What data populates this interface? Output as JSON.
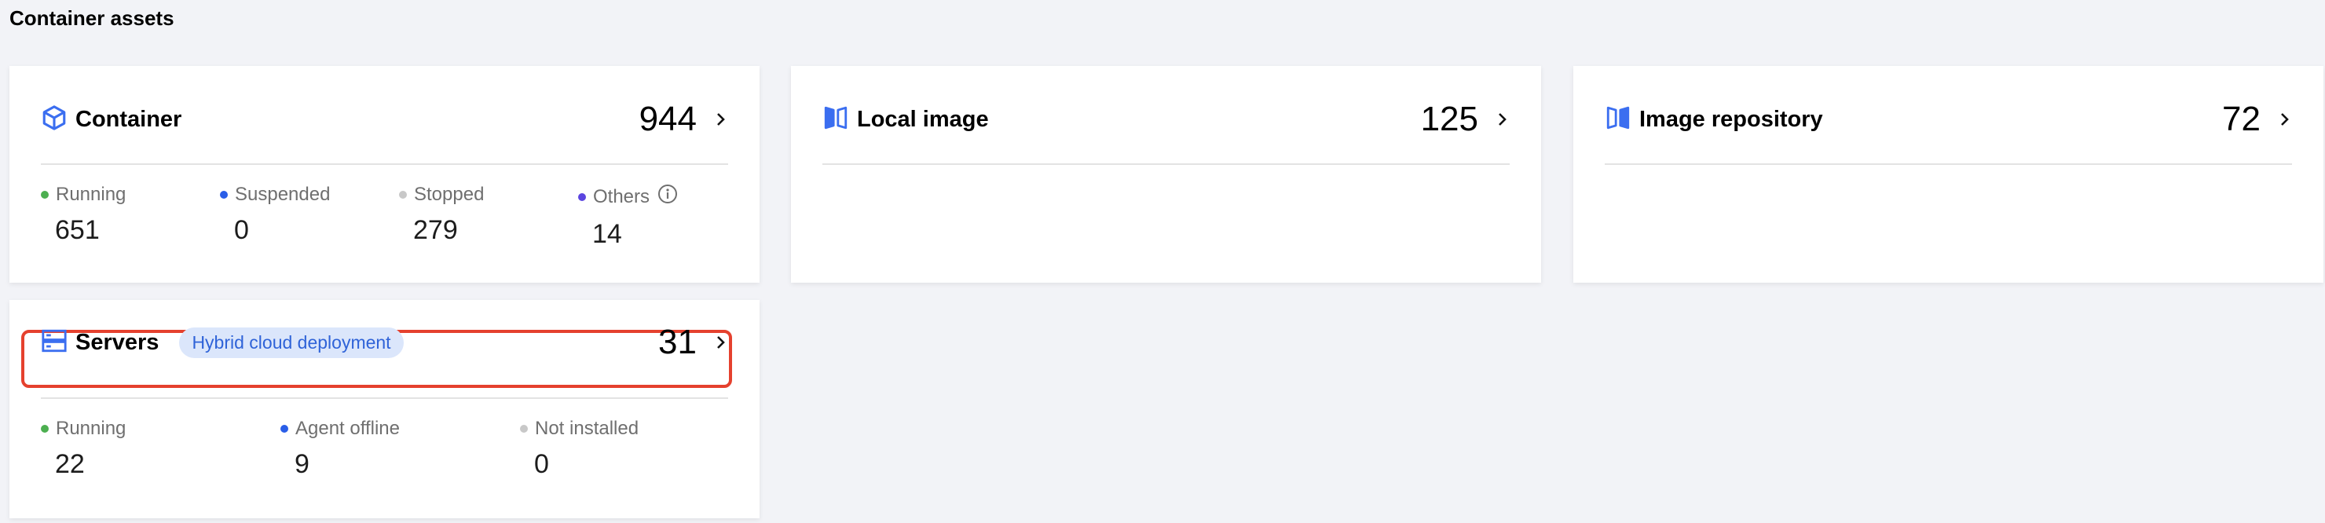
{
  "section": {
    "title": "Container assets"
  },
  "cards": {
    "container": {
      "title": "Container",
      "count": "944",
      "stats": [
        {
          "label": "Running",
          "value": "651",
          "color": "#4caf50"
        },
        {
          "label": "Suspended",
          "value": "0",
          "color": "#2a5ee8"
        },
        {
          "label": "Stopped",
          "value": "279",
          "color": "#c8c8c8"
        },
        {
          "label": "Others",
          "value": "14",
          "color": "#5b45e0"
        }
      ]
    },
    "local_image": {
      "title": "Local image",
      "count": "125"
    },
    "image_repository": {
      "title": "Image repository",
      "count": "72"
    },
    "servers": {
      "title": "Servers",
      "tag": "Hybrid cloud deployment",
      "count": "31",
      "stats": [
        {
          "label": "Running",
          "value": "22",
          "color": "#4caf50"
        },
        {
          "label": "Agent offline",
          "value": "9",
          "color": "#2a5ee8"
        },
        {
          "label": "Not installed",
          "value": "0",
          "color": "#c8c8c8"
        }
      ]
    }
  },
  "colors": {
    "accent": "#3b6ef0",
    "highlight": "#e5412e"
  },
  "icons": [
    "cube-icon",
    "image-icon",
    "image-repository-icon",
    "server-icon",
    "chevron-right-icon",
    "info-icon"
  ]
}
